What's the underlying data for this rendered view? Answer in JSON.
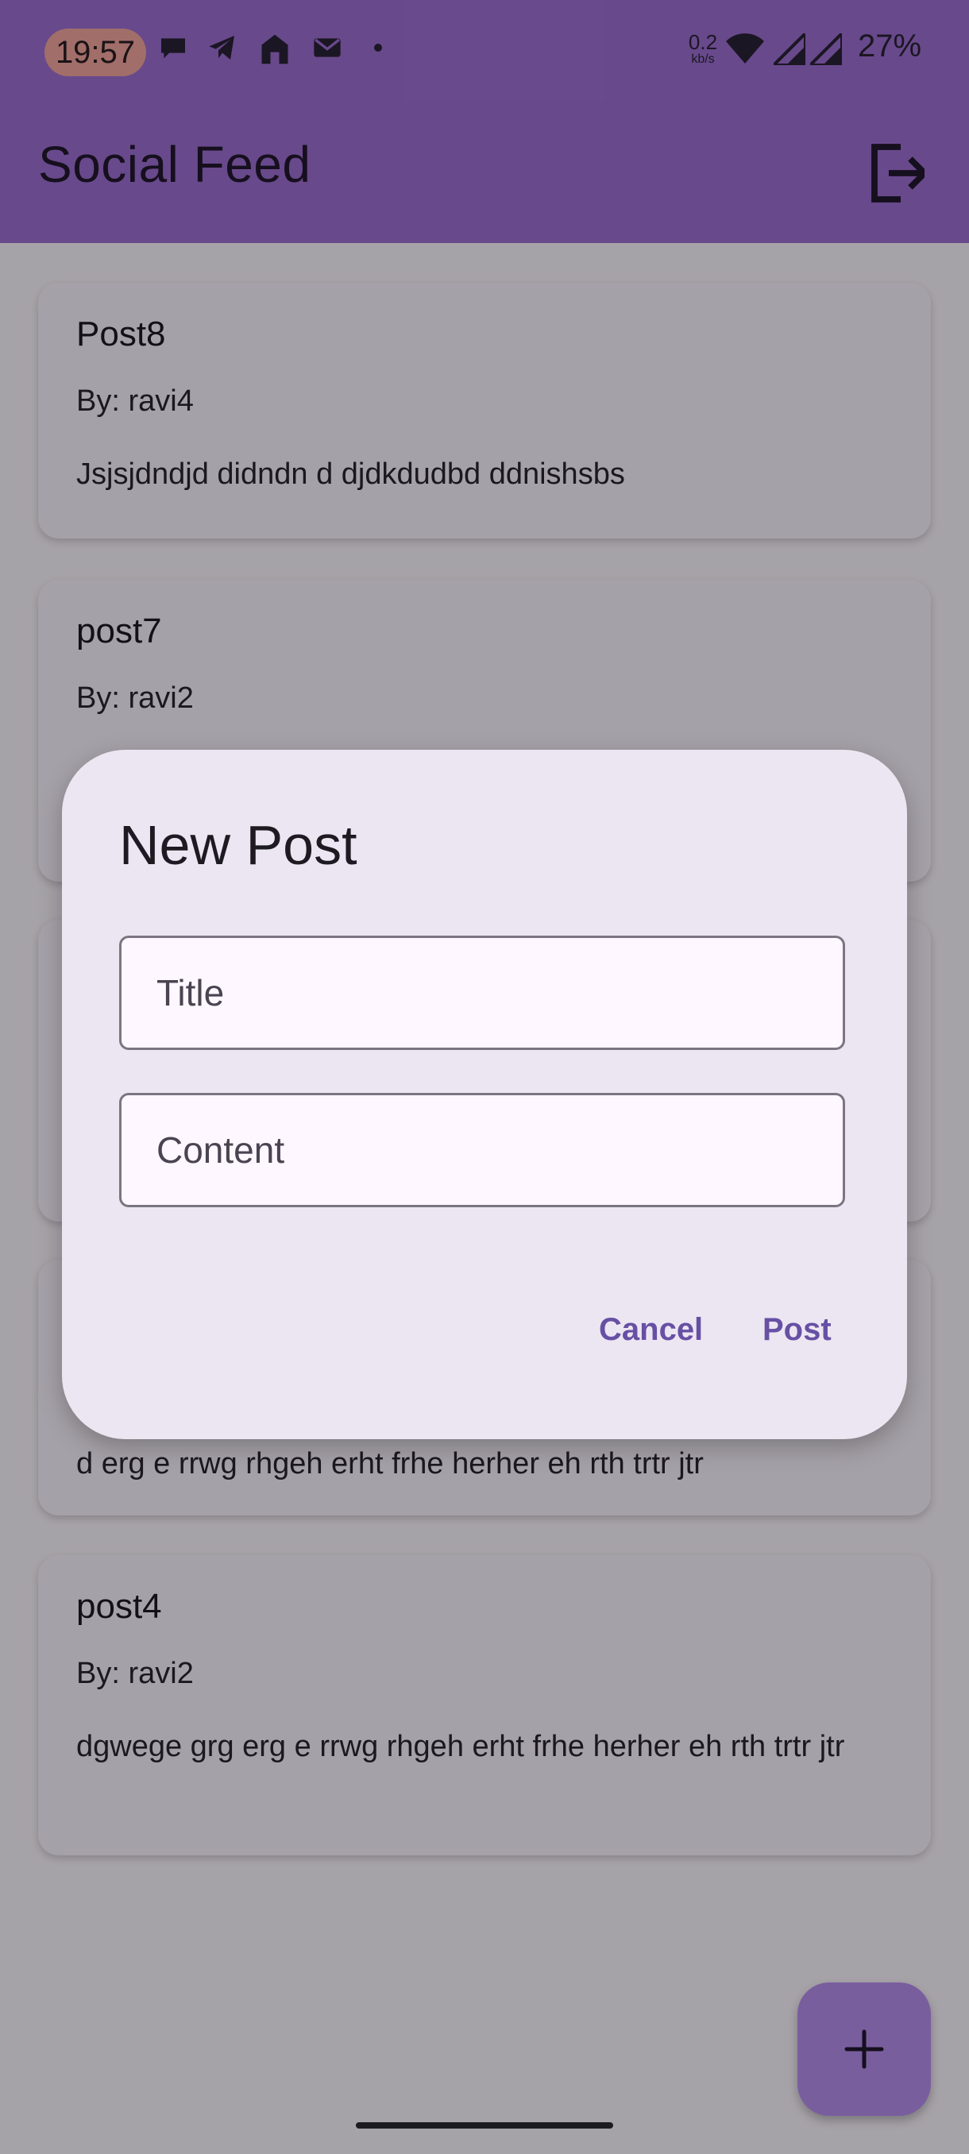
{
  "status_bar": {
    "time": "19:57",
    "net_speed_value": "0.2",
    "net_speed_unit": "kb/s",
    "battery": "27%",
    "icons": [
      "chat-bubble-icon",
      "telegram-icon",
      "home-icon",
      "mail-icon",
      "dot-icon",
      "wifi-icon",
      "signal-icon",
      "signal-icon"
    ]
  },
  "app_bar": {
    "title": "Social Feed",
    "action_icon": "logout-icon"
  },
  "posts": [
    {
      "title": "Post8",
      "author": "By: ravi4",
      "content": "Jsjsjdndjd didndn d djdkdudbd ddnishsbs"
    },
    {
      "title": "post7",
      "author": "By: ravi2",
      "content": ""
    },
    {
      "title": "",
      "author": "",
      "content": ""
    },
    {
      "title": "",
      "author": "",
      "content": "d erg e rrwg rhgeh erht frhe herher eh rth trtr jtr"
    },
    {
      "title": "post4",
      "author": "By: ravi2",
      "content": "dgwege grg erg e rrwg rhgeh erht frhe herher eh rth trtr jtr"
    }
  ],
  "fab": {
    "icon": "plus-icon"
  },
  "dialog": {
    "title": "New Post",
    "title_field": {
      "placeholder": "Title",
      "value": ""
    },
    "content_field": {
      "placeholder": "Content",
      "value": ""
    },
    "cancel_label": "Cancel",
    "post_label": "Post"
  },
  "colors": {
    "app_bar": "#9f70d4",
    "accent": "#6750a4",
    "dialog_surface": "#ece6f2",
    "fab": "#b88ff0"
  }
}
